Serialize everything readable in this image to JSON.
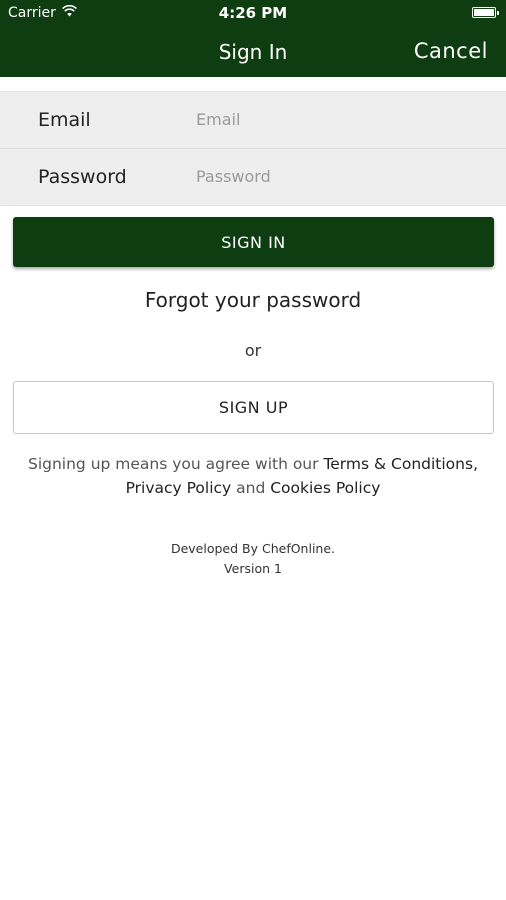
{
  "status_bar": {
    "carrier": "Carrier",
    "time": "4:26 PM",
    "wifi_icon": "wifi-icon",
    "battery_icon": "battery-icon"
  },
  "nav_bar": {
    "title": "Sign In",
    "cancel_label": "Cancel",
    "background_color": "#0f3d12"
  },
  "form": {
    "email": {
      "label": "Email",
      "placeholder": "Email",
      "value": ""
    },
    "password": {
      "label": "Password",
      "placeholder": "Password",
      "value": ""
    }
  },
  "actions": {
    "sign_in_label": "SIGN IN",
    "forgot_label": "Forgot your password",
    "or_label": "or",
    "sign_up_label": "SIGN UP"
  },
  "terms": {
    "prefix": "Signing up means you agree with our ",
    "terms_link": "Terms & Conditions,",
    "privacy_link": "Privacy Policy",
    "and": " and ",
    "cookies_link": "Cookies Policy"
  },
  "footer": {
    "developer": "Developed By ChefOnline.",
    "version": "Version 1"
  },
  "colors": {
    "accent": "#0f3d12",
    "form_background": "#eeeeee"
  }
}
